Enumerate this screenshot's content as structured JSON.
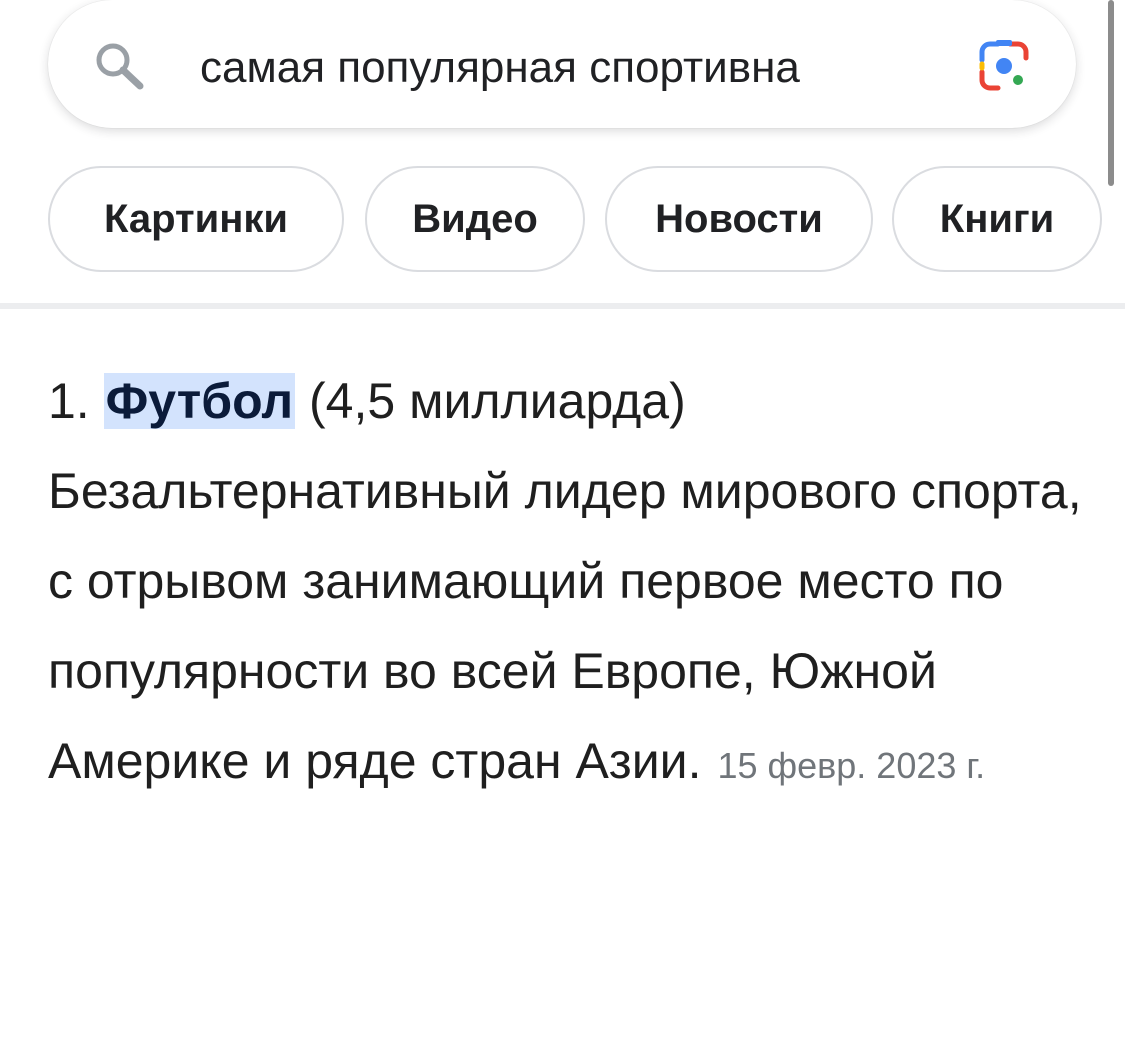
{
  "search": {
    "query": "самая популярная спортивна",
    "search_icon": "search-icon",
    "lens_icon": "google-lens-icon"
  },
  "chips": [
    {
      "label": "Картинки"
    },
    {
      "label": "Видео"
    },
    {
      "label": "Новости"
    },
    {
      "label": "Книги"
    }
  ],
  "result": {
    "number": "1.",
    "highlight": "Футбол",
    "after_highlight": " (4,5 миллиарда)",
    "body": "Безальтернативный лидер мирового спорта, с отрывом занимающий первое место по популярности во всей Европе, Южной Америке и ряде стран Азии.",
    "date": "15 февр. 2023 г."
  },
  "colors": {
    "highlight_bg": "#d3e3fd",
    "lens_blue": "#4285f4",
    "lens_red": "#ea4335",
    "lens_yellow": "#fbbc04",
    "lens_green": "#34a853"
  }
}
